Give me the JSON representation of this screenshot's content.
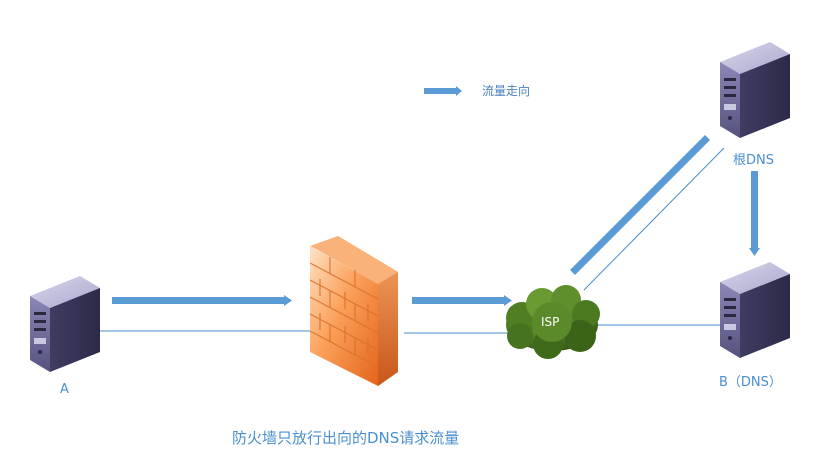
{
  "legend": {
    "label": "流量走向"
  },
  "nodes": {
    "host_a": {
      "label": "A"
    },
    "root_dns": {
      "label": "根DNS"
    },
    "b_dns": {
      "label": "B（DNS）"
    },
    "isp": {
      "label": "ISP"
    }
  },
  "caption": "防火墙只放行出向的DNS请求流量",
  "colors": {
    "arrow": "#5b9bd5",
    "link": "#4a8fd0",
    "label": "#4a8fd0",
    "server_body": "#6b6898",
    "firewall": "#ef7c2a",
    "cloud": "#4e7d24"
  }
}
